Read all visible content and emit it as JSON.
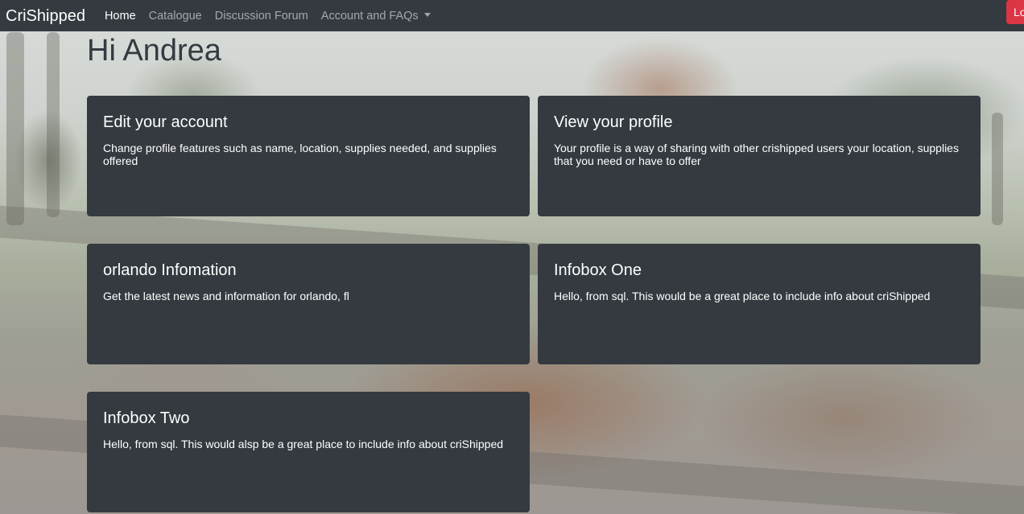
{
  "navbar": {
    "brand": "CriShipped",
    "links": [
      {
        "label": "Home"
      },
      {
        "label": "Catalogue"
      },
      {
        "label": "Discussion Forum"
      },
      {
        "label": "Account and FAQs"
      }
    ],
    "logout_label": "Lo"
  },
  "greeting": "Hi Andrea",
  "cards": [
    {
      "title": "Edit your account",
      "text": "Change profile features such as name, location, supplies needed, and supplies offered"
    },
    {
      "title": "View your profile",
      "text": "Your profile is a way of sharing with other crishipped users your location, supplies that you need or have to offer"
    },
    {
      "title": "orlando Infomation",
      "text": "Get the latest news and information for orlando, fl"
    },
    {
      "title": "Infobox One",
      "text": "Hello, from sql. This would be a great place to include info about criShipped"
    },
    {
      "title": "Infobox Two",
      "text": "Hello, from sql. This would alsp be a great place to include info about criShipped"
    }
  ],
  "colors": {
    "navbar_bg": "#343a40",
    "card_bg": "#343a40",
    "logout_bg": "#dc3545"
  }
}
